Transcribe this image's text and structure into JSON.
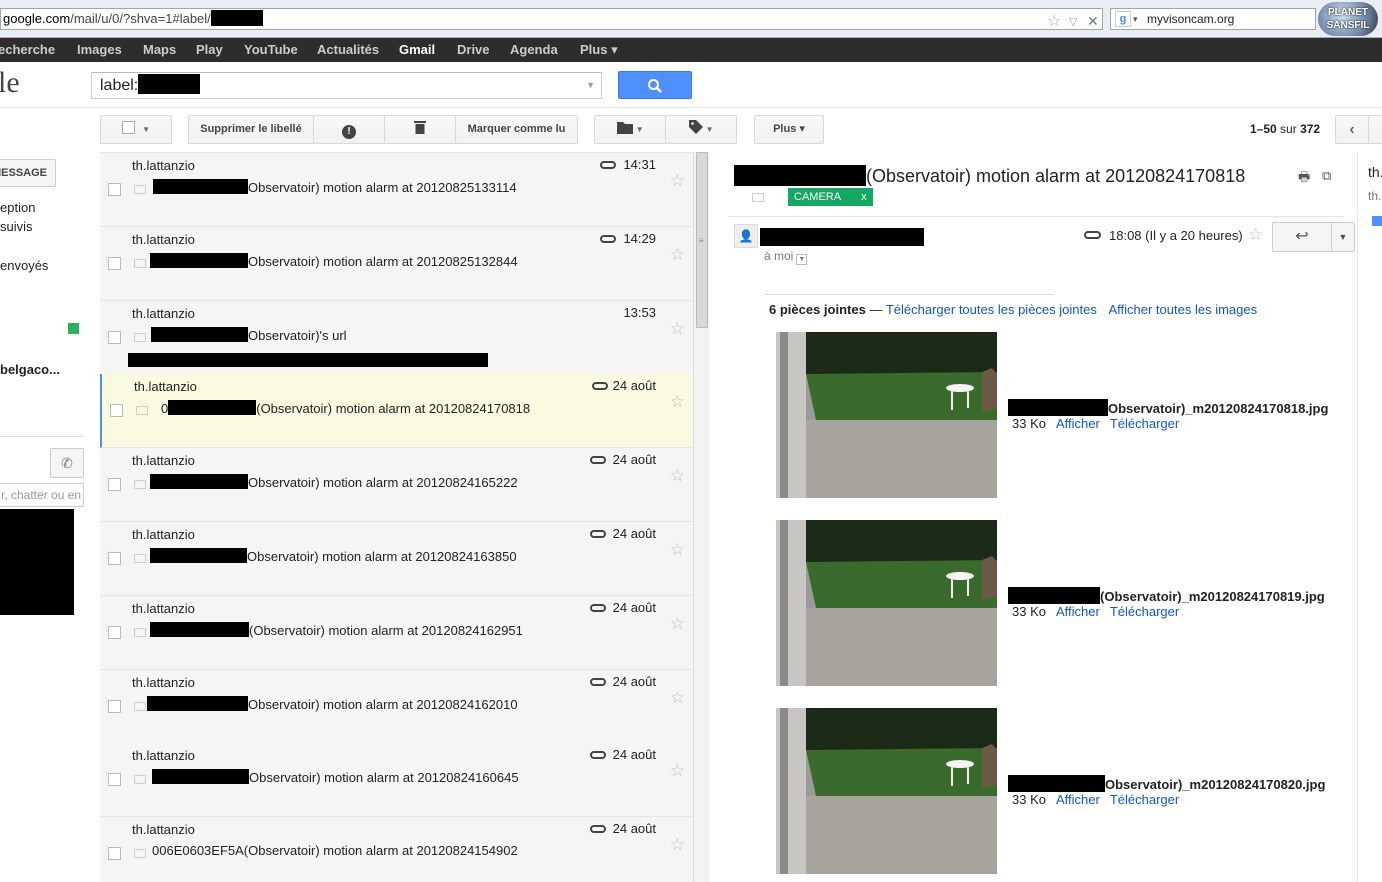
{
  "browser": {
    "url_domain": "google.com",
    "url_path": "/mail/u/0/?shva=1#label/",
    "search_engine_text": "myvisoncam.org",
    "badge_line1": "PLANET",
    "badge_line2": "SANSFIL"
  },
  "gbar": {
    "items": [
      "echerche",
      "Images",
      "Maps",
      "Play",
      "YouTube",
      "Actualités",
      "Gmail",
      "Drive",
      "Agenda",
      "Plus ▾"
    ]
  },
  "header": {
    "logo_fragment": "le",
    "search_value": "label:"
  },
  "toolbar": {
    "remove_label": "Supprimer le libellé",
    "mark_read": "Marquer comme lu",
    "more": "Plus ▾",
    "pager_range": "1–50",
    "pager_of": "sur",
    "pager_total": "372"
  },
  "leftnav": {
    "compose_label": "MESSAGE",
    "items": [
      "eption",
      "suivis",
      "envoyés",
      "belgaco..."
    ],
    "chat_placeholder": "r, chatter ou en"
  },
  "messages": [
    {
      "sender": "th.lattanzio",
      "date": "14:31",
      "attachment": true,
      "prefix": "",
      "subject": "Observatoir) motion alarm at 20120825133114",
      "selected": false
    },
    {
      "sender": "th.lattanzio",
      "date": "14:29",
      "attachment": true,
      "prefix": "",
      "subject": "Observatoir) motion alarm at 20120825132844",
      "selected": false
    },
    {
      "sender": "th.lattanzio",
      "date": "13:53",
      "attachment": false,
      "prefix": "",
      "subject": "Observatoir)'s url",
      "selected": false,
      "snippet": true
    },
    {
      "sender": "th.lattanzio",
      "date": "24 août",
      "attachment": true,
      "prefix": "0",
      "subject": "(Observatoir) motion alarm at 20120824170818",
      "selected": true
    },
    {
      "sender": "th.lattanzio",
      "date": "24 août",
      "attachment": true,
      "prefix": "",
      "subject": "Observatoir) motion alarm at 20120824165222",
      "selected": false
    },
    {
      "sender": "th.lattanzio",
      "date": "24 août",
      "attachment": true,
      "prefix": "",
      "subject": "Observatoir) motion alarm at 20120824163850",
      "selected": false
    },
    {
      "sender": "th.lattanzio",
      "date": "24 août",
      "attachment": true,
      "prefix": "",
      "subject": "(Observatoir) motion alarm at 20120824162951",
      "selected": false
    },
    {
      "sender": "th.lattanzio",
      "date": "24 août",
      "attachment": true,
      "prefix": "",
      "subject": "Observatoir) motion alarm at 20120824162010",
      "selected": false
    },
    {
      "sender": "th.lattanzio",
      "date": "24 août",
      "attachment": true,
      "prefix": "",
      "subject": "Observatoir) motion alarm at 20120824160645",
      "selected": false
    },
    {
      "sender": "th.lattanzio",
      "date": "24 août",
      "attachment": true,
      "prefix": "006E0603EF5A",
      "subject": "(Observatoir) motion alarm at 20120824154902",
      "selected": false
    }
  ],
  "reading": {
    "title": "(Observatoir) motion alarm at 20120824170818",
    "label_tag": "CAMERA",
    "label_remove": "x",
    "to_me": "à moi",
    "time": "18:08 (Il y a 20 heures)",
    "attachments_count": "6 pièces jointes",
    "attachments_dash": "—",
    "download_all": "Télécharger toutes les pièces jointes",
    "show_all_images": "Afficher toutes les images",
    "attachments": [
      {
        "name": "Observatoir)_m20120824170818.jpg",
        "size": "33 Ko",
        "view": "Afficher",
        "download": "Télécharger"
      },
      {
        "name": "(Observatoir)_m20120824170819.jpg",
        "size": "33 Ko",
        "view": "Afficher",
        "download": "Télécharger"
      },
      {
        "name": "Observatoir)_m20120824170820.jpg",
        "size": "33 Ko",
        "view": "Afficher",
        "download": "Télécharger"
      }
    ]
  },
  "right_strip": {
    "line1": "th.",
    "line2": "th."
  },
  "colors": {
    "accent_blue": "#4d90fe",
    "label_green": "#16a765",
    "selected_row": "#fafae0",
    "link": "#1155cc"
  }
}
